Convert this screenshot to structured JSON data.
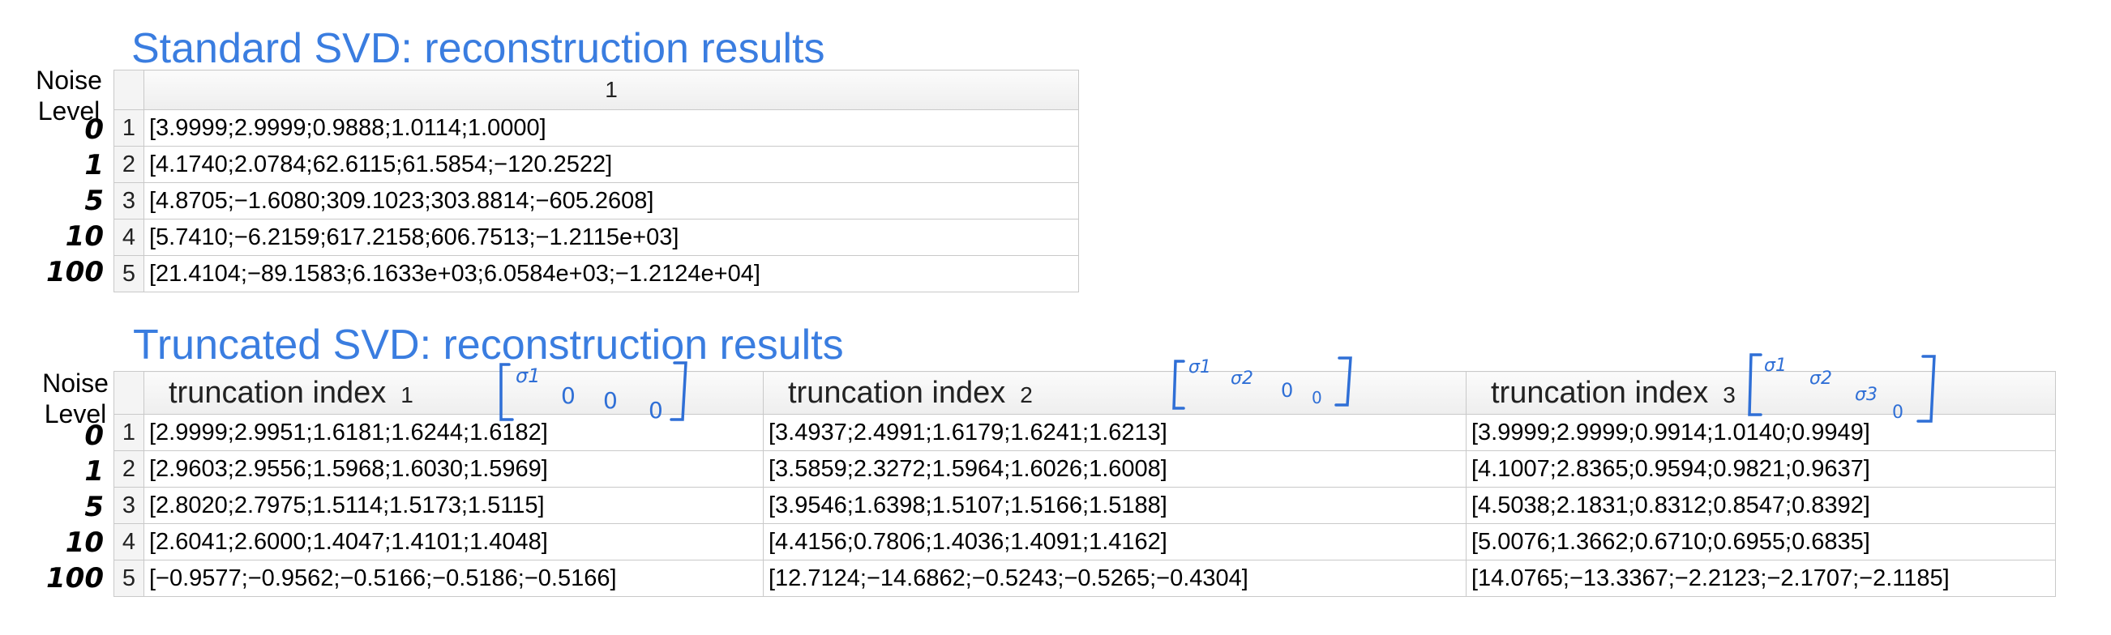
{
  "standard": {
    "title": "Standard SVD: reconstruction results",
    "noise_label": "Noise\nLevel",
    "column_header": "1",
    "rows": [
      {
        "level": "0",
        "index": "1",
        "value": "[3.9999;2.9999;0.9888;1.0114;1.0000]"
      },
      {
        "level": "1",
        "index": "2",
        "value": "[4.1740;2.0784;62.6115;61.5854;−120.2522]"
      },
      {
        "level": "5",
        "index": "3",
        "value": "[4.8705;−1.6080;309.1023;303.8814;−605.2608]"
      },
      {
        "level": "10",
        "index": "4",
        "value": "[5.7410;−6.2159;617.2158;606.7513;−1.2115e+03]"
      },
      {
        "level": "100",
        "index": "5",
        "value": "[21.4104;−89.1583;6.1633e+03;6.0584e+03;−1.2124e+04]"
      }
    ]
  },
  "truncated": {
    "title": "Truncated SVD: reconstruction results",
    "noise_label": "Noise\nLevel",
    "column_label": "truncation index",
    "columns": [
      {
        "index": "1",
        "annotation": [
          "σ1",
          "0",
          "0",
          "0"
        ]
      },
      {
        "index": "2",
        "annotation": [
          "σ1",
          "σ2",
          "0",
          "0"
        ]
      },
      {
        "index": "3",
        "annotation": [
          "σ1",
          "σ2",
          "σ3",
          "0"
        ]
      }
    ],
    "rows": [
      {
        "level": "0",
        "index": "1",
        "values": [
          "[2.9999;2.9951;1.6181;1.6244;1.6182]",
          "[3.4937;2.4991;1.6179;1.6241;1.6213]",
          "[3.9999;2.9999;0.9914;1.0140;0.9949]"
        ]
      },
      {
        "level": "1",
        "index": "2",
        "values": [
          "[2.9603;2.9556;1.5968;1.6030;1.5969]",
          "[3.5859;2.3272;1.5964;1.6026;1.6008]",
          "[4.1007;2.8365;0.9594;0.9821;0.9637]"
        ]
      },
      {
        "level": "5",
        "index": "3",
        "values": [
          "[2.8020;2.7975;1.5114;1.5173;1.5115]",
          "[3.9546;1.6398;1.5107;1.5166;1.5188]",
          "[4.5038;2.1831;0.8312;0.8547;0.8392]"
        ]
      },
      {
        "level": "10",
        "index": "4",
        "values": [
          "[2.6041;2.6000;1.4047;1.4101;1.4048]",
          "[4.4156;0.7806;1.4036;1.4091;1.4162]",
          "[5.0076;1.3662;0.6710;0.6955;0.6835]"
        ]
      },
      {
        "level": "100",
        "index": "5",
        "values": [
          "[−0.9577;−0.9562;−0.5166;−0.5186;−0.5166]",
          "[12.7124;−14.6862;−0.5243;−0.5265;−0.4304]",
          "[14.0765;−13.3367;−2.2123;−2.1707;−2.1185]"
        ]
      }
    ]
  },
  "colors": {
    "title": "#3a7de0",
    "handwriting": "#2f6fd6"
  }
}
